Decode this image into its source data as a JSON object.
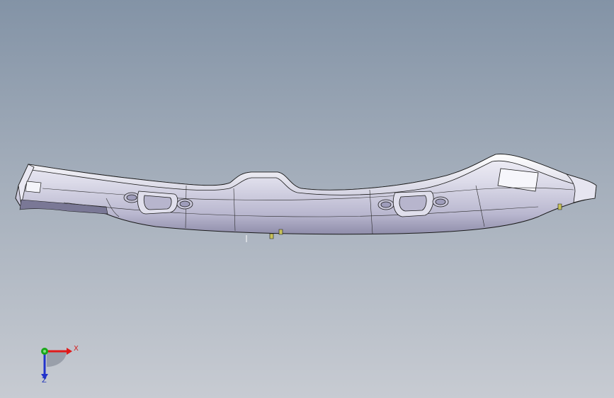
{
  "triad": {
    "x_label": "X",
    "z_label": "Z",
    "y_label": "",
    "colors": {
      "x": "#e01a1a",
      "y": "#1aa81a",
      "z": "#2233cc"
    }
  },
  "model": {
    "name": "",
    "body_color": "#d6d4e4",
    "edge_color": "#1a1a1a"
  },
  "viewport": {
    "background_top": "#8393a6",
    "background_bottom": "#c7cbd2"
  }
}
